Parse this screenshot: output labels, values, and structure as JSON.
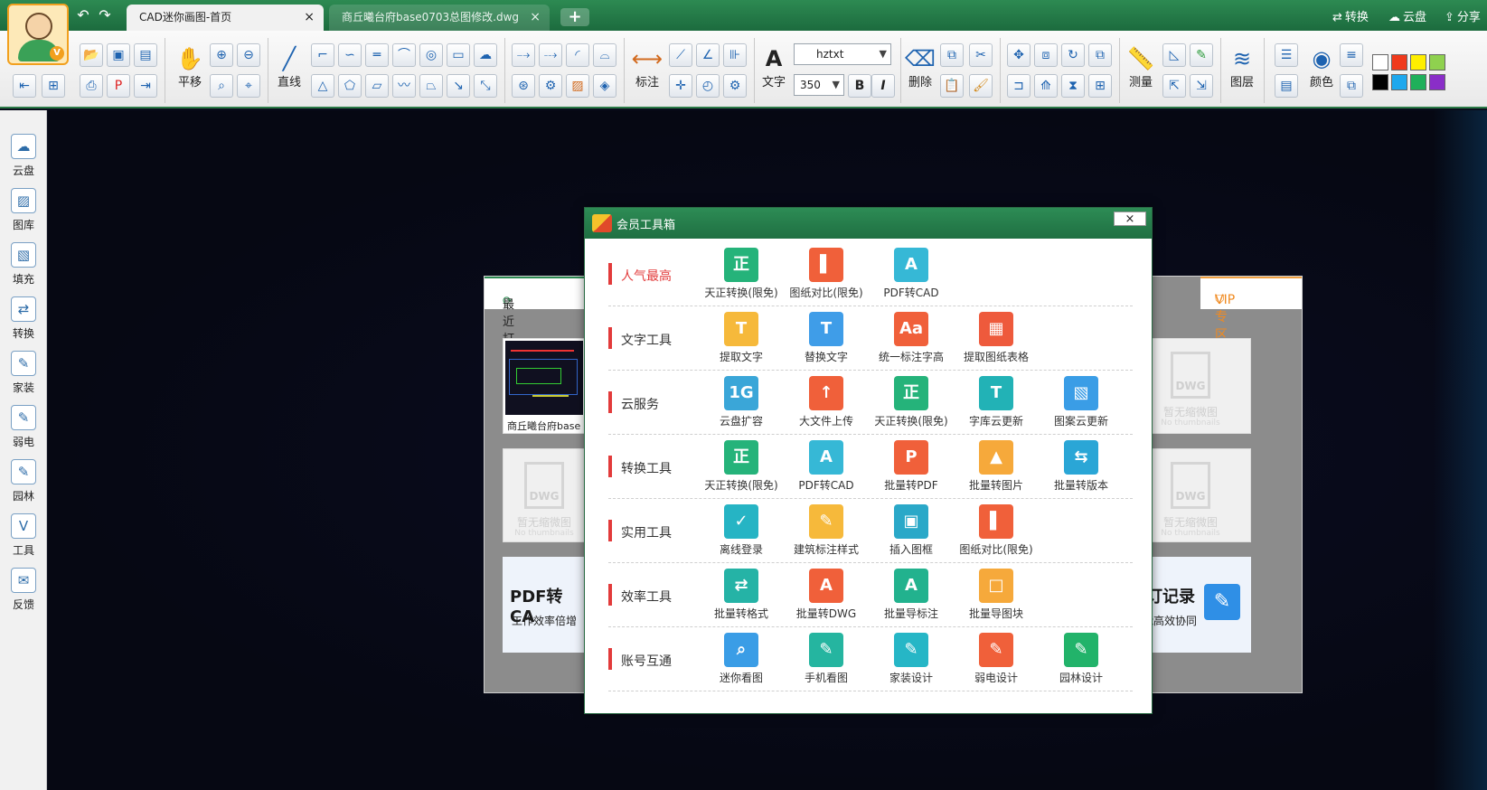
{
  "titlebar": {
    "tabs": [
      {
        "label": "CAD迷你画图-首页",
        "close": "×"
      },
      {
        "label": "商丘曦台府base0703总图修改.dwg",
        "close": "×"
      }
    ],
    "new_tab": "+",
    "right_actions": [
      {
        "icon": "convert-icon",
        "label": "转换"
      },
      {
        "icon": "cloud-icon",
        "label": "云盘"
      },
      {
        "icon": "share-icon",
        "label": "分享"
      }
    ]
  },
  "ribbon": {
    "pan_label": "平移",
    "line_label": "直线",
    "dim_label": "标注",
    "text_label": "文字",
    "font_value": "hztxt",
    "size_value": "350",
    "bold": "B",
    "italic": "I",
    "delete_label": "删除",
    "measure_label": "测量",
    "layer_label": "图层",
    "color_label": "颜色",
    "colors": [
      "#ffffff",
      "#f03a1c",
      "#ffee00",
      "#8fd14f",
      "#000000",
      "#1ea8ee",
      "#1fb05a",
      "#8a2ec8"
    ]
  },
  "sidebar": {
    "items": [
      {
        "icon": "cloud-icon",
        "label": "云盘"
      },
      {
        "icon": "gallery-icon",
        "label": "图库"
      },
      {
        "icon": "hatch-icon",
        "label": "填充"
      },
      {
        "icon": "convert-icon",
        "label": "转换"
      },
      {
        "icon": "home-decor-icon",
        "label": "家装"
      },
      {
        "icon": "weak-current-icon",
        "label": "弱电"
      },
      {
        "icon": "garden-icon",
        "label": "园林"
      },
      {
        "icon": "tools-icon",
        "label": "工具"
      },
      {
        "icon": "feedback-icon",
        "label": "反馈"
      }
    ]
  },
  "start_panel": {
    "recent_title": "最近打开",
    "vip_title": "VIP专区",
    "recent_file": "商丘曦台府base",
    "no_thumb_cn": "暂无缩微图",
    "no_thumb_en": "No thumbnails",
    "dwg": "DWG",
    "promo_left_title": "PDF转CA",
    "promo_left_sub": "工作效率倍增",
    "promo_right_title": "修订记录",
    "promo_right_sub": "智能高效协同"
  },
  "dialog": {
    "title": "会员工具箱",
    "close": "×",
    "categories": [
      {
        "label": "人气最高",
        "hot": true,
        "tools": [
          {
            "name": "天正转换(限免)",
            "color": "#25b37a",
            "glyph": "正"
          },
          {
            "name": "图纸对比(限免)",
            "color": "#f0603a",
            "glyph": "▌"
          },
          {
            "name": "PDF转CAD",
            "color": "#36b8d6",
            "glyph": "A"
          }
        ]
      },
      {
        "label": "文字工具",
        "hot": false,
        "tools": [
          {
            "name": "提取文字",
            "color": "#f6b93b",
            "glyph": "T"
          },
          {
            "name": "替换文字",
            "color": "#3f9de8",
            "glyph": "T"
          },
          {
            "name": "统一标注字高",
            "color": "#f0603a",
            "glyph": "Aa"
          },
          {
            "name": "提取图纸表格",
            "color": "#ee5a3c",
            "glyph": "▦"
          }
        ]
      },
      {
        "label": "云服务",
        "hot": false,
        "tools": [
          {
            "name": "云盘扩容",
            "color": "#3aa6d8",
            "glyph": "1G"
          },
          {
            "name": "大文件上传",
            "color": "#f0603a",
            "glyph": "↑"
          },
          {
            "name": "天正转换(限免)",
            "color": "#25b37a",
            "glyph": "正"
          },
          {
            "name": "字库云更新",
            "color": "#22b2b6",
            "glyph": "T"
          },
          {
            "name": "图案云更新",
            "color": "#3a9de6",
            "glyph": "▧"
          }
        ]
      },
      {
        "label": "转换工具",
        "hot": false,
        "tools": [
          {
            "name": "天正转换(限免)",
            "color": "#25b37a",
            "glyph": "正"
          },
          {
            "name": "PDF转CAD",
            "color": "#36b8d6",
            "glyph": "A"
          },
          {
            "name": "批量转PDF",
            "color": "#f0603a",
            "glyph": "P"
          },
          {
            "name": "批量转图片",
            "color": "#f6a93b",
            "glyph": "▲"
          },
          {
            "name": "批量转版本",
            "color": "#2aa6d6",
            "glyph": "⇆"
          }
        ]
      },
      {
        "label": "实用工具",
        "hot": false,
        "tools": [
          {
            "name": "离线登录",
            "color": "#26b4c4",
            "glyph": "✓"
          },
          {
            "name": "建筑标注样式",
            "color": "#f6b93b",
            "glyph": "✎"
          },
          {
            "name": "插入图框",
            "color": "#2aa8c8",
            "glyph": "▣"
          },
          {
            "name": "图纸对比(限免)",
            "color": "#f0603a",
            "glyph": "▌"
          }
        ]
      },
      {
        "label": "效率工具",
        "hot": false,
        "tools": [
          {
            "name": "批量转格式",
            "color": "#25b3a6",
            "glyph": "⇄"
          },
          {
            "name": "批量转DWG",
            "color": "#f0603a",
            "glyph": "A"
          },
          {
            "name": "批量导标注",
            "color": "#22b28e",
            "glyph": "A"
          },
          {
            "name": "批量导图块",
            "color": "#f6a93b",
            "glyph": "□"
          }
        ]
      },
      {
        "label": "账号互通",
        "hot": false,
        "tools": [
          {
            "name": "迷你看图",
            "color": "#3a9de6",
            "glyph": "⌕"
          },
          {
            "name": "手机看图",
            "color": "#25b5a0",
            "glyph": "✎"
          },
          {
            "name": "家装设计",
            "color": "#26b6c6",
            "glyph": "✎"
          },
          {
            "name": "弱电设计",
            "color": "#f0603a",
            "glyph": "✎"
          },
          {
            "name": "园林设计",
            "color": "#22b36a",
            "glyph": "✎"
          }
        ]
      }
    ]
  }
}
